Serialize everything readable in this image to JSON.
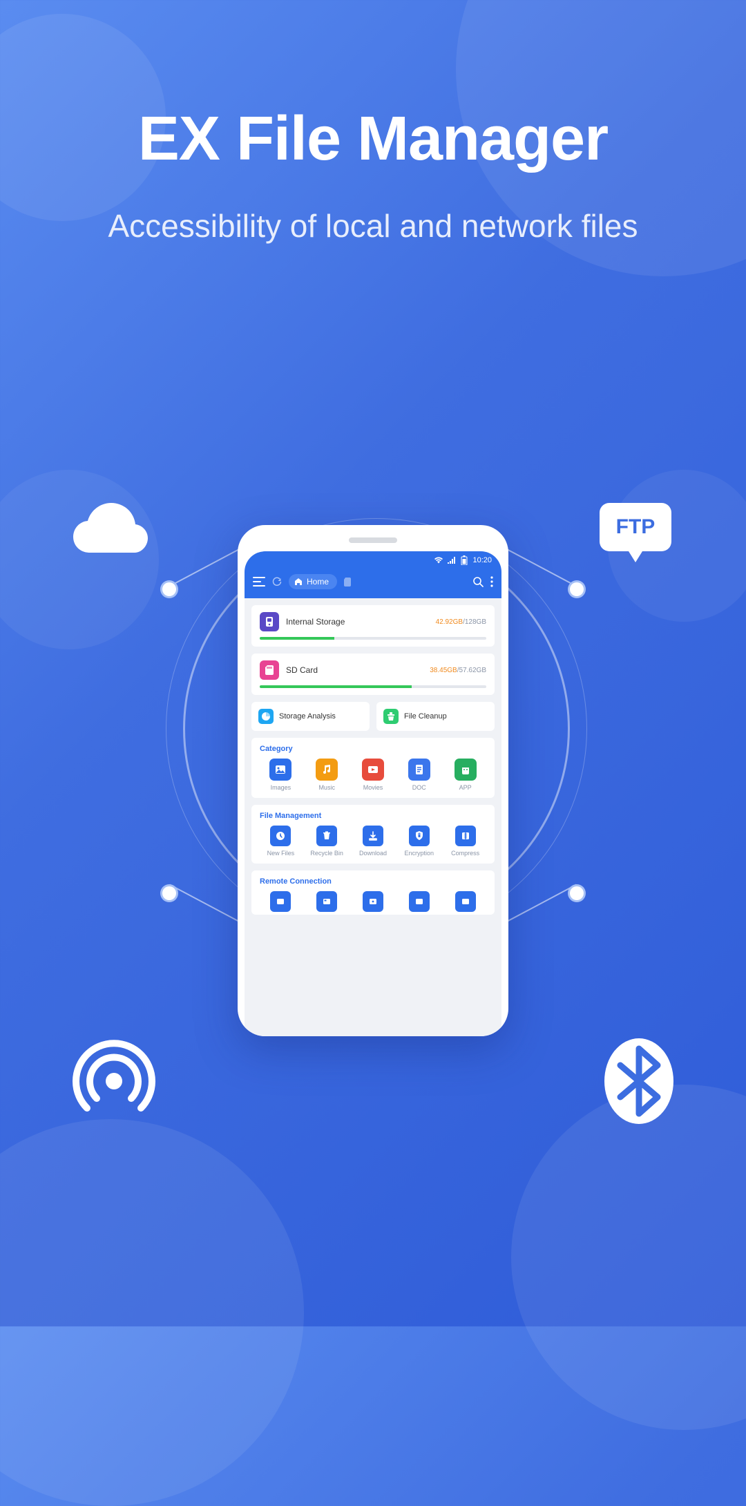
{
  "hero": {
    "title": "EX File Manager",
    "subtitle": "Accessibility of local and network files"
  },
  "floating": {
    "ftp_label": "FTP"
  },
  "statusbar": {
    "time": "10:20"
  },
  "toolbar": {
    "home_label": "Home"
  },
  "storage": {
    "internal": {
      "label": "Internal Storage",
      "used": "42.92GB",
      "total": "128GB",
      "percent": 33
    },
    "sdcard": {
      "label": "SD Card",
      "used": "38.45GB",
      "total": "57.62GB",
      "percent": 67
    }
  },
  "tools": {
    "analysis": "Storage Analysis",
    "cleanup": "File Cleanup"
  },
  "category": {
    "title": "Category",
    "items": [
      {
        "label": "Images"
      },
      {
        "label": "Music"
      },
      {
        "label": "Movies"
      },
      {
        "label": "DOC"
      },
      {
        "label": "APP"
      }
    ]
  },
  "fileManagement": {
    "title": "File Management",
    "items": [
      {
        "label": "New Files"
      },
      {
        "label": "Recycle Bin"
      },
      {
        "label": "Download"
      },
      {
        "label": "Encryption"
      },
      {
        "label": "Compress"
      }
    ]
  },
  "remote": {
    "title": "Remote Connection"
  }
}
